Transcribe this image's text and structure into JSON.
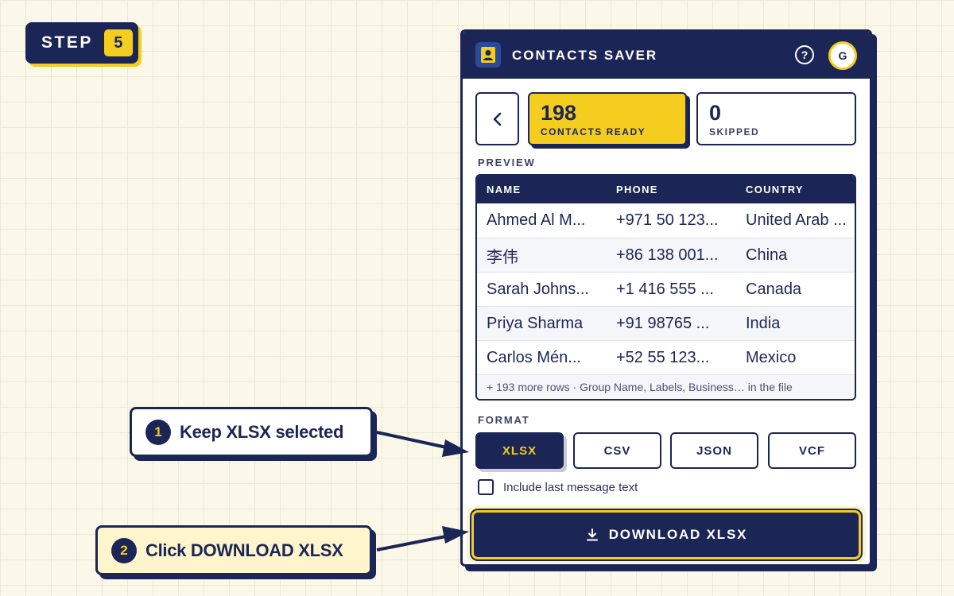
{
  "step": {
    "label": "STEP",
    "number": "5"
  },
  "app": {
    "title": "CONTACTS SAVER",
    "help_icon": "?",
    "avatar_initial": "G"
  },
  "stats": {
    "ready": {
      "value": "198",
      "label": "CONTACTS READY"
    },
    "skipped": {
      "value": "0",
      "label": "SKIPPED"
    }
  },
  "preview": {
    "label": "PREVIEW",
    "columns": [
      "NAME",
      "PHONE",
      "COUNTRY"
    ],
    "rows": [
      [
        "Ahmed Al M...",
        "+971 50 123...",
        "United Arab ..."
      ],
      [
        "李伟",
        "+86 138 001...",
        "China"
      ],
      [
        "Sarah Johns...",
        "+1 416 555 ...",
        "Canada"
      ],
      [
        "Priya Sharma",
        "+91 98765 ...",
        "India"
      ],
      [
        "Carlos Mén...",
        "+52 55 123...",
        "Mexico"
      ]
    ],
    "more": "+ 193 more rows · Group Name, Labels, Business… in the file"
  },
  "format": {
    "label": "FORMAT",
    "options": [
      "XLSX",
      "CSV",
      "JSON",
      "VCF"
    ],
    "selected": "XLSX"
  },
  "include_message": {
    "label": "Include last message text",
    "checked": false
  },
  "download": {
    "label": "DOWNLOAD XLSX"
  },
  "callouts": [
    {
      "number": "1",
      "text": "Keep XLSX selected"
    },
    {
      "number": "2",
      "text": "Click DOWNLOAD XLSX"
    }
  ],
  "colors": {
    "navy": "#1c2656",
    "yellow": "#f5cd1e",
    "background": "#fbf8ea"
  }
}
